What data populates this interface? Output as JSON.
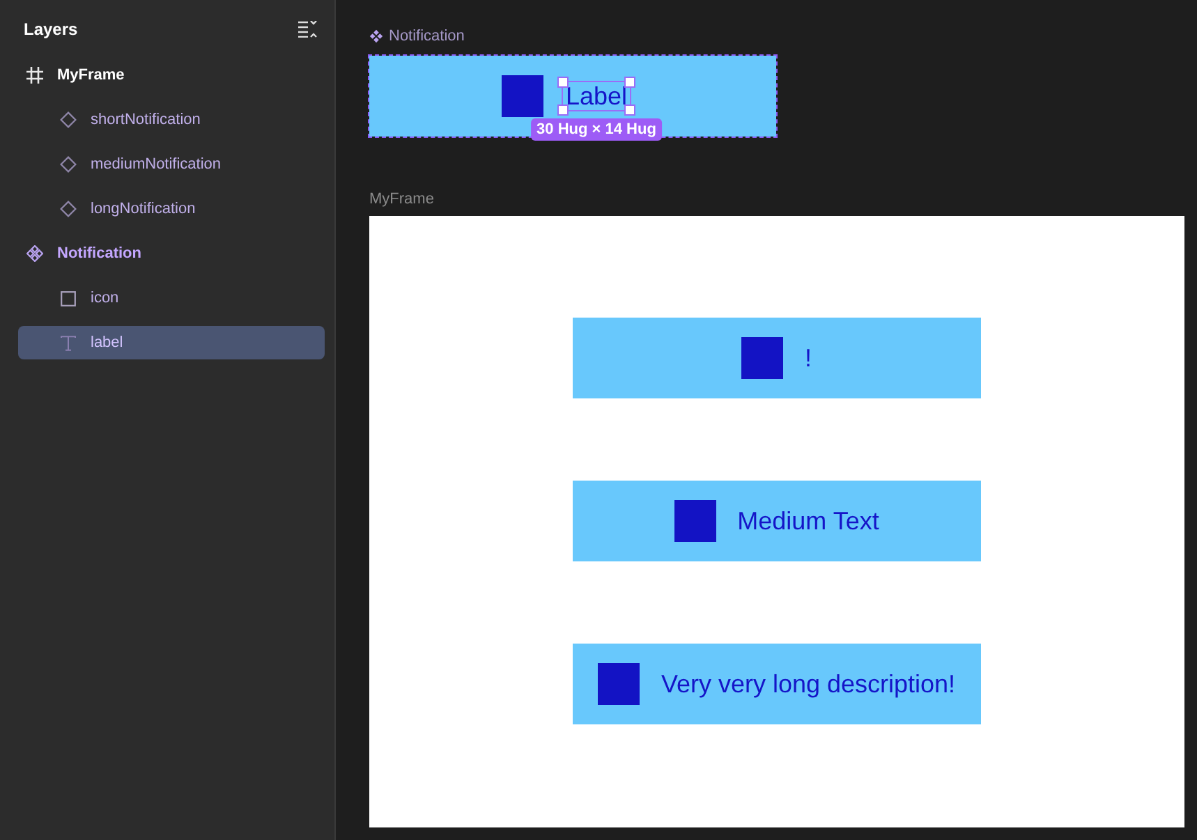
{
  "sidebar": {
    "title": "Layers",
    "layers": [
      {
        "name": "MyFrame",
        "kind": "frame",
        "selected": false,
        "children": [
          {
            "name": "shortNotification",
            "kind": "instance",
            "selected": false
          },
          {
            "name": "mediumNotification",
            "kind": "instance",
            "selected": false
          },
          {
            "name": "longNotification",
            "kind": "instance",
            "selected": false
          }
        ]
      },
      {
        "name": "Notification",
        "kind": "component",
        "selected": false,
        "children": [
          {
            "name": "icon",
            "kind": "rectangle",
            "selected": false
          },
          {
            "name": "label",
            "kind": "text",
            "selected": true
          }
        ]
      }
    ]
  },
  "component": {
    "title": "Notification",
    "label": "Label",
    "size_badge": "30 Hug × 14 Hug"
  },
  "frame": {
    "title": "MyFrame",
    "notifications": [
      "!",
      "Medium Text",
      "Very very long description!"
    ]
  }
}
